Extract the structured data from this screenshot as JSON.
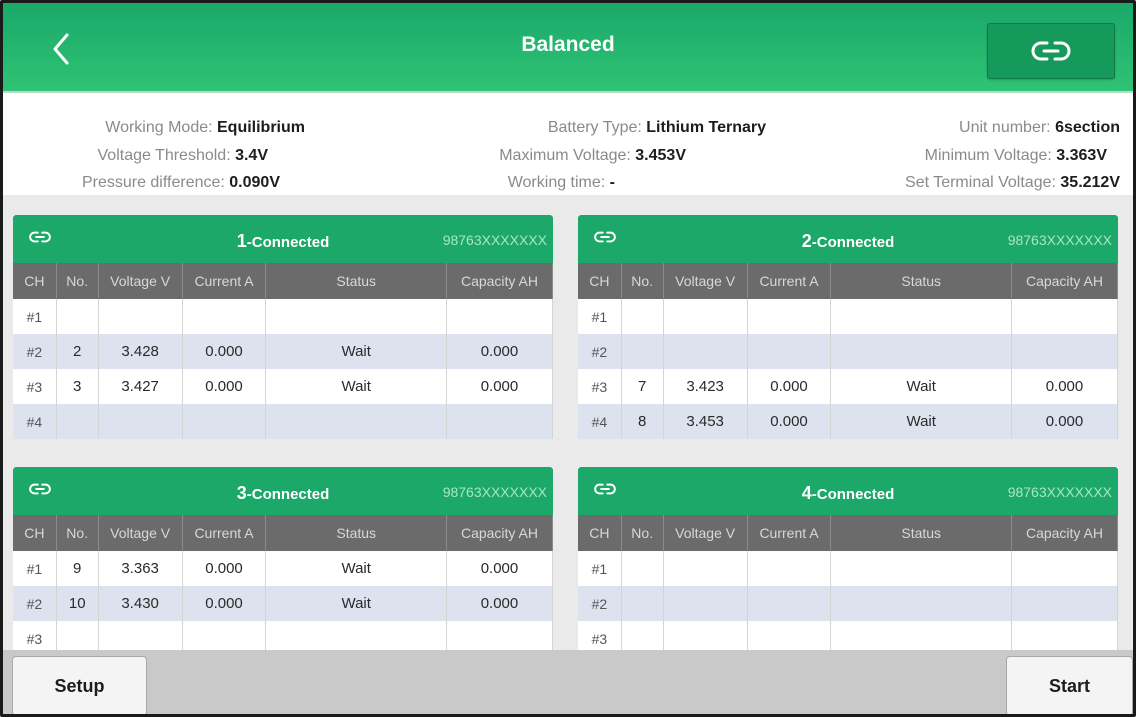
{
  "header": {
    "title": "Balanced",
    "back_icon": "chevron-left-icon",
    "link_icon": "link-icon"
  },
  "info": {
    "working_mode_label": "Working Mode: ",
    "working_mode": "Equilibrium",
    "battery_type_label": "Battery Type: ",
    "battery_type": "Lithium Ternary",
    "unit_number_label": "Unit number: ",
    "unit_number": "6section",
    "voltage_threshold_label": "Voltage Threshold: ",
    "voltage_threshold": "3.4V",
    "max_voltage_label": "Maximum Voltage: ",
    "max_voltage": "3.453V",
    "min_voltage_label": "Minimum Voltage: ",
    "min_voltage": "3.363V",
    "pressure_diff_label": "Pressure difference: ",
    "pressure_diff": "0.090V",
    "working_time_label": "Working time: ",
    "working_time": "-",
    "set_terminal_label": "Set Terminal Voltage: ",
    "set_terminal": "35.212V"
  },
  "columns": [
    "CH",
    "No.",
    "Voltage V",
    "Current A",
    "Status",
    "Capacity AH"
  ],
  "panels": [
    {
      "num": "1",
      "status": "-Connected",
      "id": "98763XXXXXXX",
      "rows": [
        [
          "#1",
          "",
          "",
          "",
          "",
          ""
        ],
        [
          "#2",
          "2",
          "3.428",
          "0.000",
          "Wait",
          "0.000"
        ],
        [
          "#3",
          "3",
          "3.427",
          "0.000",
          "Wait",
          "0.000"
        ],
        [
          "#4",
          "",
          "",
          "",
          "",
          ""
        ]
      ]
    },
    {
      "num": "2",
      "status": "-Connected",
      "id": "98763XXXXXXX",
      "rows": [
        [
          "#1",
          "",
          "",
          "",
          "",
          ""
        ],
        [
          "#2",
          "",
          "",
          "",
          "",
          ""
        ],
        [
          "#3",
          "7",
          "3.423",
          "0.000",
          "Wait",
          "0.000"
        ],
        [
          "#4",
          "8",
          "3.453",
          "0.000",
          "Wait",
          "0.000"
        ]
      ]
    },
    {
      "num": "3",
      "status": "-Connected",
      "id": "98763XXXXXXX",
      "rows": [
        [
          "#1",
          "9",
          "3.363",
          "0.000",
          "Wait",
          "0.000"
        ],
        [
          "#2",
          "10",
          "3.430",
          "0.000",
          "Wait",
          "0.000"
        ],
        [
          "#3",
          "",
          "",
          "",
          "",
          ""
        ]
      ]
    },
    {
      "num": "4",
      "status": "-Connected",
      "id": "98763XXXXXXX",
      "rows": [
        [
          "#1",
          "",
          "",
          "",
          "",
          ""
        ],
        [
          "#2",
          "",
          "",
          "",
          "",
          ""
        ],
        [
          "#3",
          "",
          "",
          "",
          "",
          ""
        ]
      ]
    }
  ],
  "footer": {
    "setup_label": "Setup",
    "start_label": "Start"
  },
  "colors": {
    "header_green": "#1ca868",
    "table_header": "#6b6b6b",
    "alt_row": "#dce3ef"
  }
}
